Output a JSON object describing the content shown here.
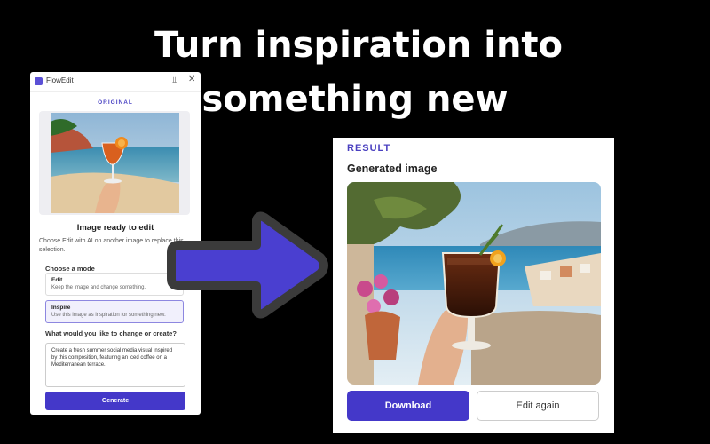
{
  "headline": {
    "line1": "Turn inspiration into",
    "line2": "something new"
  },
  "left_panel": {
    "app_title": "FlowEdit",
    "original_label": "ORIGINAL",
    "ready_title": "Image ready to edit",
    "description": "Choose Edit with AI on another image to replace this selection.",
    "mode_label": "Choose a mode",
    "options": [
      {
        "title": "Edit",
        "subtitle": "Keep the image and change something."
      },
      {
        "title": "Inspire",
        "subtitle": "Use this image as inspiration for something new."
      }
    ],
    "selected_option": "Inspire",
    "change_label": "What would you like to change or create?",
    "prompt_value": "Create a fresh summer social media visual inspired by this composition, featuring an iced coffee on a Mediterranean terrace.",
    "generate_label": "Generate"
  },
  "right_panel": {
    "result_label": "RESULT",
    "generated_title": "Generated image",
    "download_label": "Download",
    "edit_again_label": "Edit again"
  },
  "colors": {
    "accent": "#4438c9",
    "background": "#000000",
    "arrow": "#4a3fd0"
  }
}
